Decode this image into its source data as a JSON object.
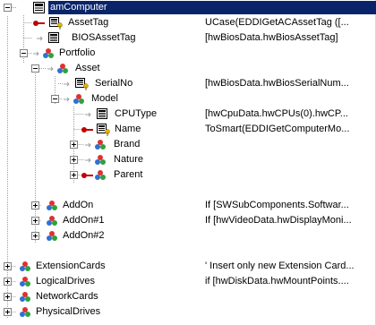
{
  "tree": {
    "root": {
      "label": "amComputer"
    },
    "rows": [
      {
        "label": "AssetTag",
        "value": "UCase(EDDIGetACAssetTag ([..."
      },
      {
        "label": "BIOSAssetTag",
        "value": "[hwBiosData.hwBiosAssetTag]"
      },
      {
        "label": "Portfolio",
        "value": ""
      },
      {
        "label": "Asset",
        "value": ""
      },
      {
        "label": "SerialNo",
        "value": "[hwBiosData.hwBiosSerialNum..."
      },
      {
        "label": "Model",
        "value": ""
      },
      {
        "label": "CPUType",
        "value": "[hwCpuData.hwCPUs(0).hwCP..."
      },
      {
        "label": "Name",
        "value": "ToSmart(EDDIGetComputerMo..."
      },
      {
        "label": "Brand",
        "value": ""
      },
      {
        "label": "Nature",
        "value": ""
      },
      {
        "label": "Parent",
        "value": ""
      },
      {
        "label": "AddOn",
        "value": "If [SWSubComponents.Softwar..."
      },
      {
        "label": "AddOn#1",
        "value": "If [hwVideoData.hwDisplayMoni..."
      },
      {
        "label": "AddOn#2",
        "value": ""
      },
      {
        "label": "ExtensionCards",
        "value": "' Insert only new Extension Card..."
      },
      {
        "label": "LogicalDrives",
        "value": "if [hwDiskData.hwMountPoints...."
      },
      {
        "label": "NetworkCards",
        "value": ""
      },
      {
        "label": "PhysicalDrives",
        "value": ""
      }
    ]
  },
  "colors": {
    "selection": "#0a246a",
    "tree_line": "#a0a0a0"
  }
}
